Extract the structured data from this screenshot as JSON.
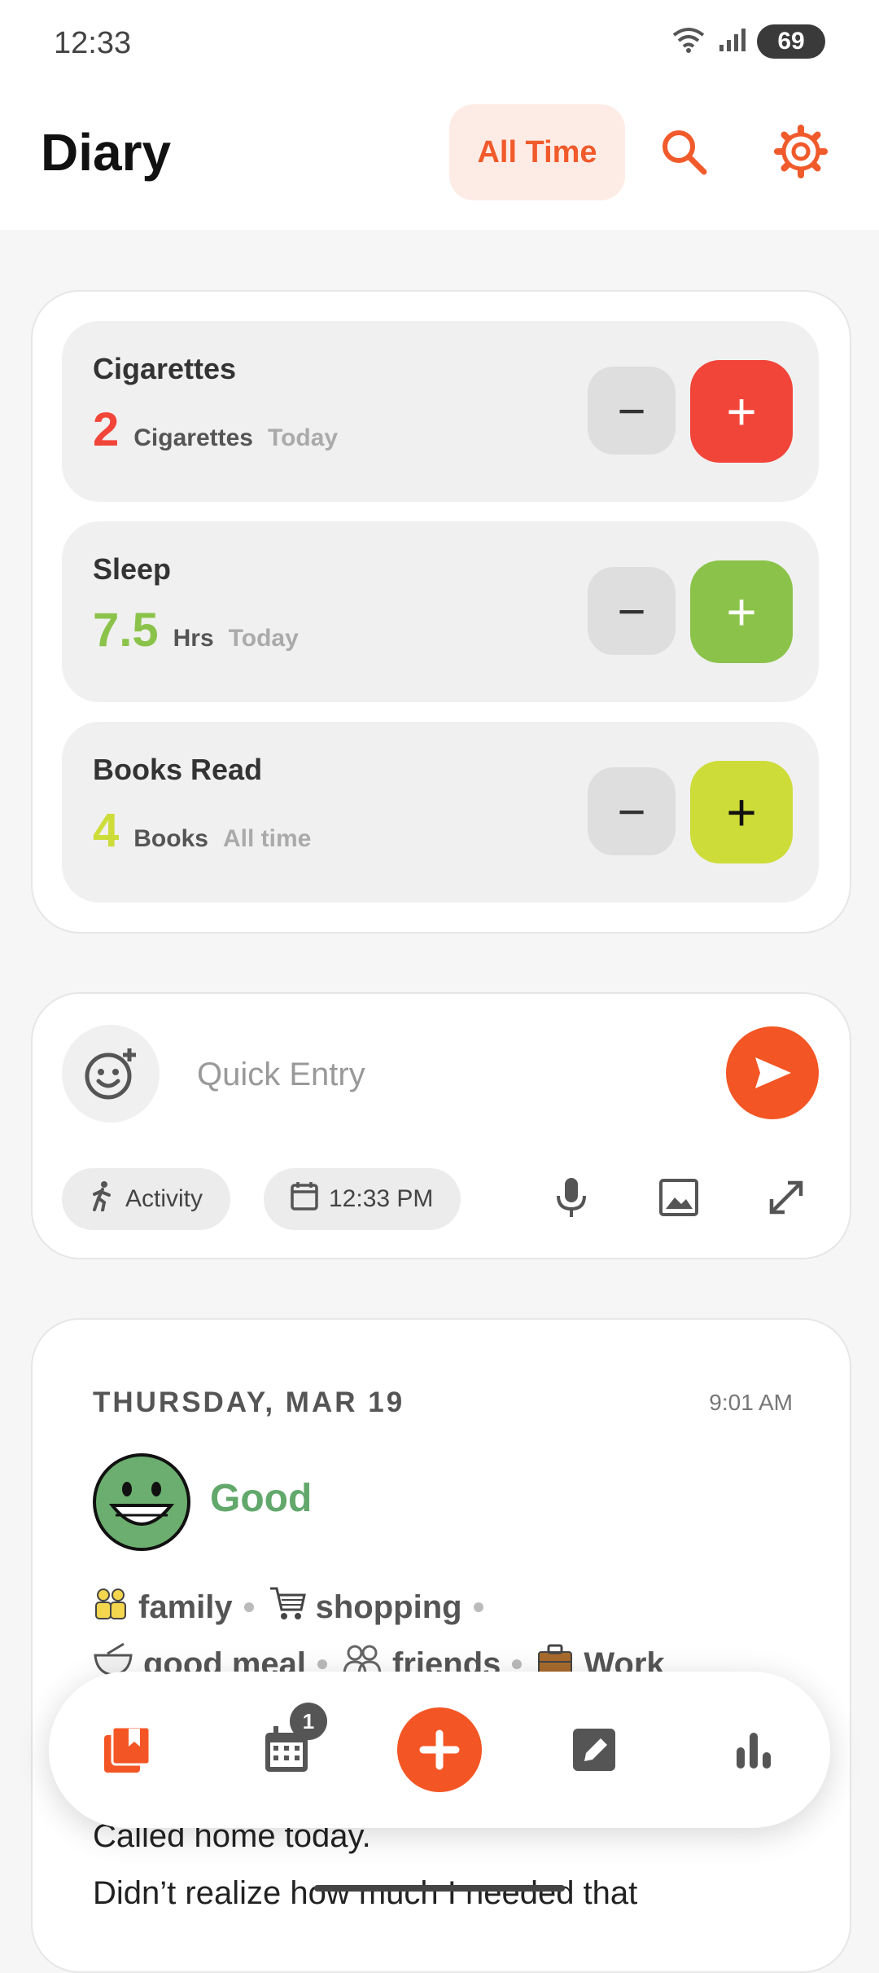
{
  "status_bar": {
    "time": "12:33",
    "battery": "69",
    "icons": [
      "wifi-icon",
      "signal-icon"
    ]
  },
  "header": {
    "title": "Diary",
    "filter_label": "All Time",
    "icons": [
      "search-icon",
      "settings-icon"
    ]
  },
  "colors": {
    "accent": "#f45524",
    "red": "#f2453a",
    "green": "#8bc34a",
    "lime": "#cddc39",
    "mood_good": "#62a86b"
  },
  "counters": [
    {
      "name": "Cigarettes",
      "value": "2",
      "unit": "Cigarettes",
      "period": "Today",
      "color": "#f2453a"
    },
    {
      "name": "Sleep",
      "value": "7.5",
      "unit": "Hrs",
      "period": "Today",
      "color": "#8bc34a"
    },
    {
      "name": "Books Read",
      "value": "4",
      "unit": "Books",
      "period": "All time",
      "color": "#cddc39"
    }
  ],
  "quick_entry": {
    "placeholder": "Quick Entry",
    "activity_label": "Activity",
    "time_label": "12:33 PM",
    "icons": [
      "add-emoji-icon",
      "send-icon",
      "activity-icon",
      "calendar-icon",
      "microphone-icon",
      "image-icon",
      "expand-icon"
    ]
  },
  "entry": {
    "date": "THURSDAY, MAR 19",
    "time": "9:01 AM",
    "mood": "Good",
    "tags_line1": [
      "family",
      "shopping"
    ],
    "tags_line2": [
      "good meal",
      "friends",
      "Work"
    ],
    "text_line1": "Called home today.",
    "text_line2": "Didn’t realize how much I needed that"
  },
  "bottom_nav": {
    "calendar_badge": "1",
    "icons": [
      "diary-icon",
      "calendar-icon",
      "add-icon",
      "edit-note-icon",
      "stats-icon"
    ]
  }
}
